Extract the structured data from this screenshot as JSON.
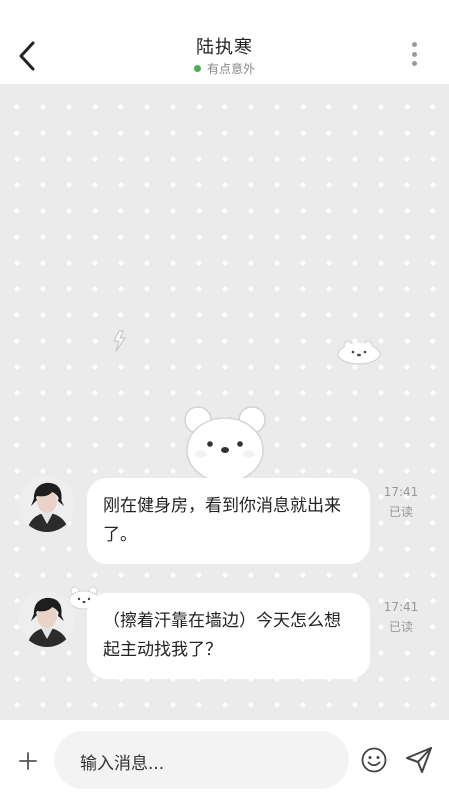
{
  "header": {
    "title": "陆执寒",
    "status_text": "有点意外",
    "status_color": "#4caf50",
    "back_icon": "chevron-left-icon",
    "more_icon": "more-vertical-icon"
  },
  "messages": [
    {
      "text": "刚在健身房，看到你消息就出来了。",
      "time": "17:41",
      "read_status": "已读"
    },
    {
      "text": "（擦着汗靠在墙边）今天怎么想起主动找我了？",
      "time": "17:41",
      "read_status": "已读"
    }
  ],
  "composer": {
    "placeholder": "输入消息...",
    "plus_icon": "plus-icon",
    "emoji_icon": "smile-icon",
    "send_icon": "send-icon"
  }
}
